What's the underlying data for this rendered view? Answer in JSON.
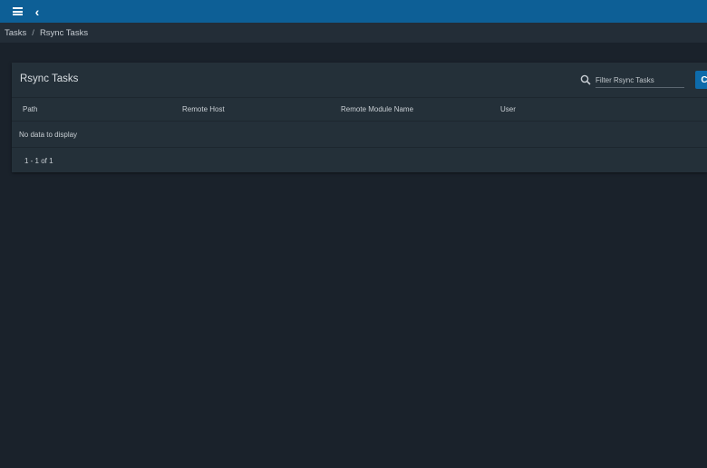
{
  "topbar": {
    "menu_icon": "hamburger-menu-icon",
    "back_icon": "chevron-left-icon",
    "back_glyph": "‹",
    "color": "#0d5f96"
  },
  "breadcrumb": {
    "items": [
      "Tasks",
      "Rsync Tasks"
    ],
    "separator": "/"
  },
  "card": {
    "title": "Rsync Tasks",
    "filter_placeholder": "Filter Rsync Tasks",
    "search_icon": "search-icon",
    "add_button_glyph": "C",
    "columns": [
      "Path",
      "Remote Host",
      "Remote Module Name",
      "User"
    ],
    "empty_message": "No data to display",
    "pagination": "1 - 1 of 1"
  },
  "colors": {
    "background": "#1a222b",
    "card": "#243039",
    "accent": "#0d6bab"
  }
}
